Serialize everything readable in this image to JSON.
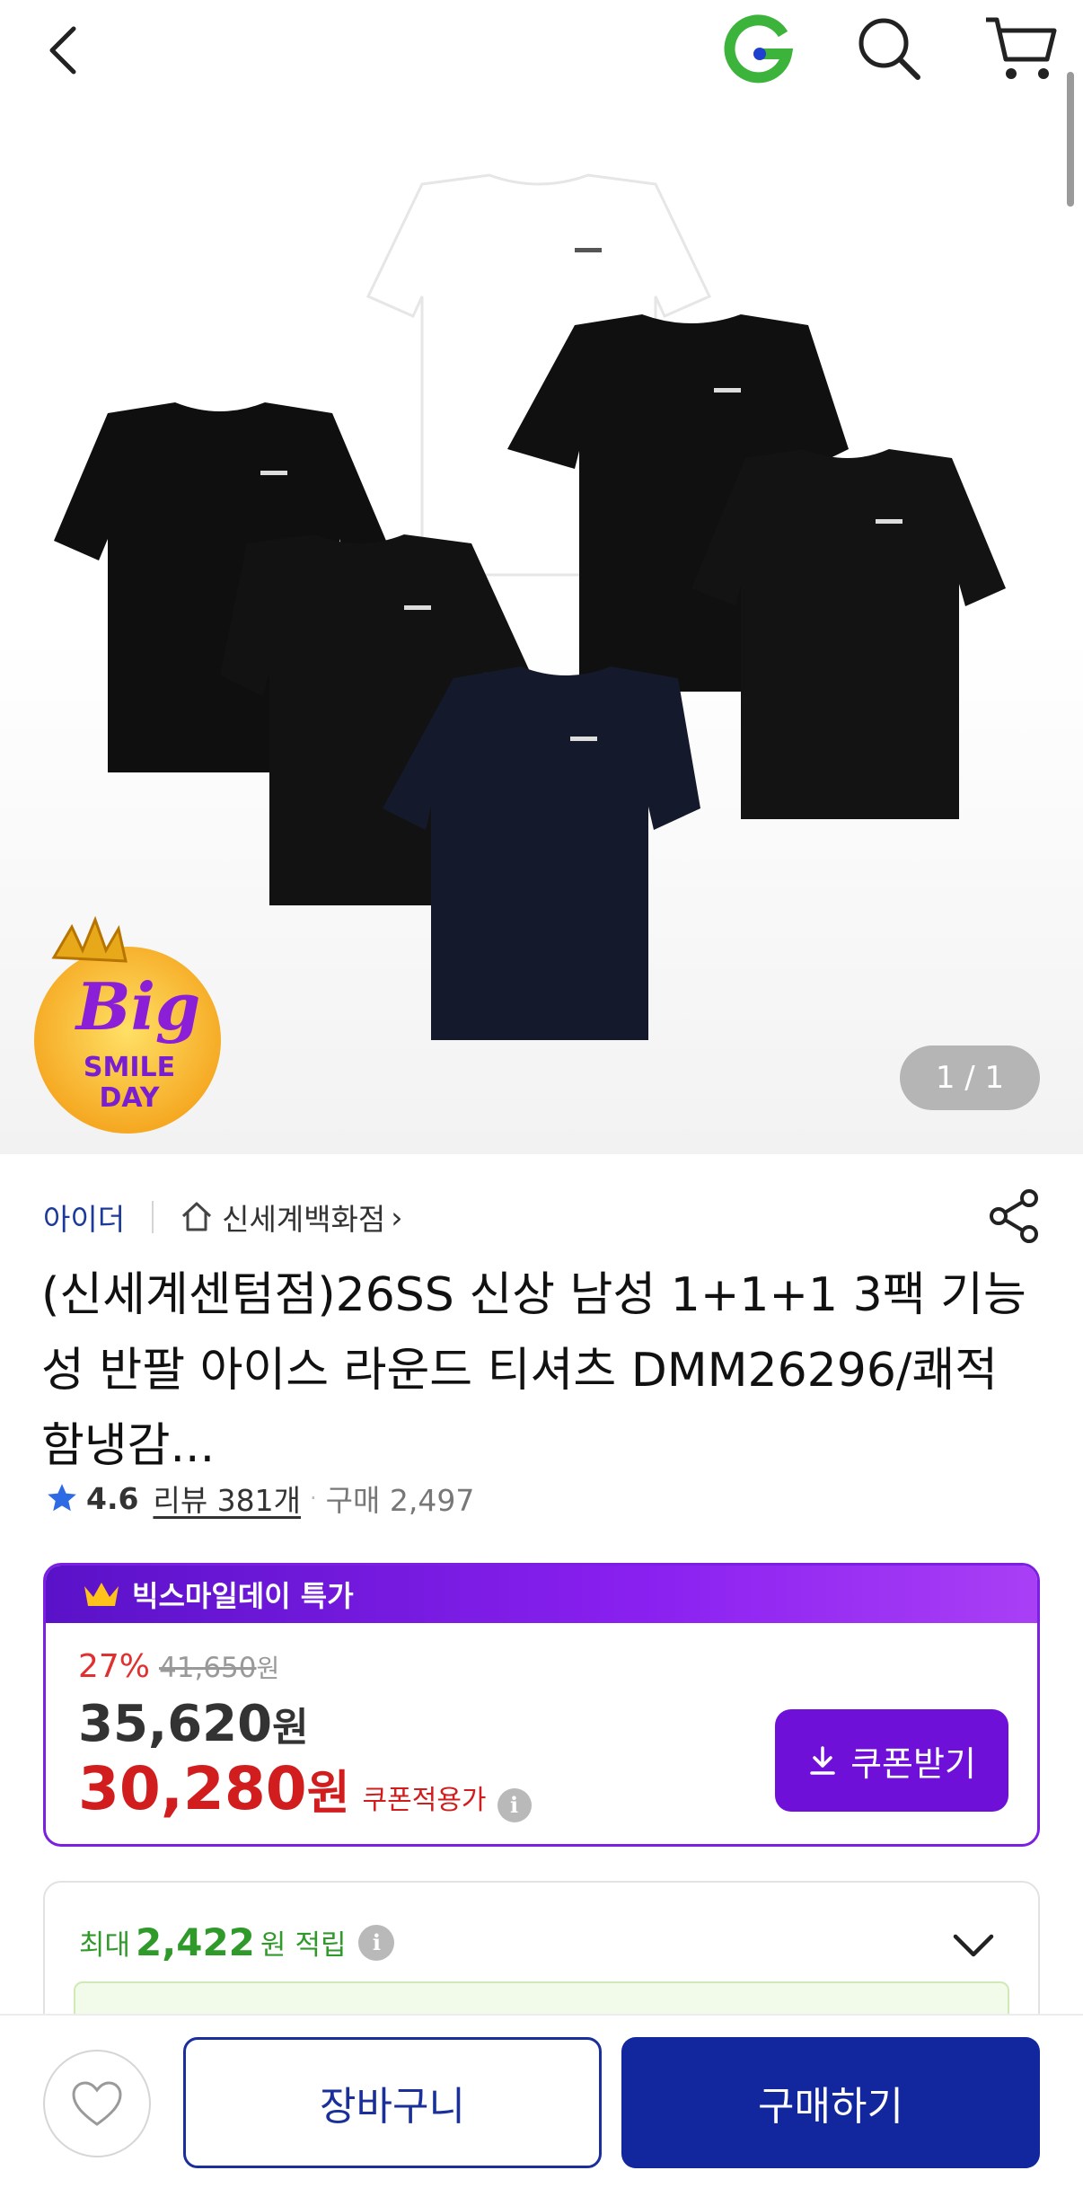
{
  "header": {
    "back_icon": "chevron-left-icon",
    "logo_icon": "gmarket-g-logo",
    "search_icon": "search-icon",
    "cart_icon": "cart-icon"
  },
  "hero": {
    "image_alt": "black and white t-shirts pack",
    "badge": {
      "line1": "Big",
      "line2": "SMILE",
      "line3": "DAY"
    },
    "counter": "1 / 1"
  },
  "seller": {
    "brand": "아이더",
    "store": "신세계백화점",
    "store_chevron": "›",
    "share_icon": "share-icon"
  },
  "product": {
    "title": "(신세계센텀점)26SS 신상 남성 1+1+1 3팩 기능성 반팔 아이스 라운드 티셔츠 DMM26296/쾌적함냉감..."
  },
  "rating": {
    "score": "4.6",
    "review_label": "리뷰 381개",
    "separator": "·",
    "purchase_label": "구매 2,497"
  },
  "deal": {
    "header": "빅스마일데이 특가",
    "discount": "27%",
    "original_price": "41,650",
    "original_unit": "원",
    "price": "35,620",
    "price_unit": "원",
    "coupon_price": "30,280",
    "coupon_unit": "원",
    "coupon_label": "쿠폰적용가",
    "info_glyph": "i",
    "coupon_button": "쿠폰받기",
    "accent_color": "#6f10d8"
  },
  "points": {
    "prefix": "최대",
    "amount": "2,422",
    "unit": "원",
    "suffix": "적립",
    "info_glyph": "i"
  },
  "bottom": {
    "wish_icon": "heart-icon",
    "cart_button": "장바구니",
    "buy_button": "구매하기",
    "primary_color": "#12269e"
  }
}
